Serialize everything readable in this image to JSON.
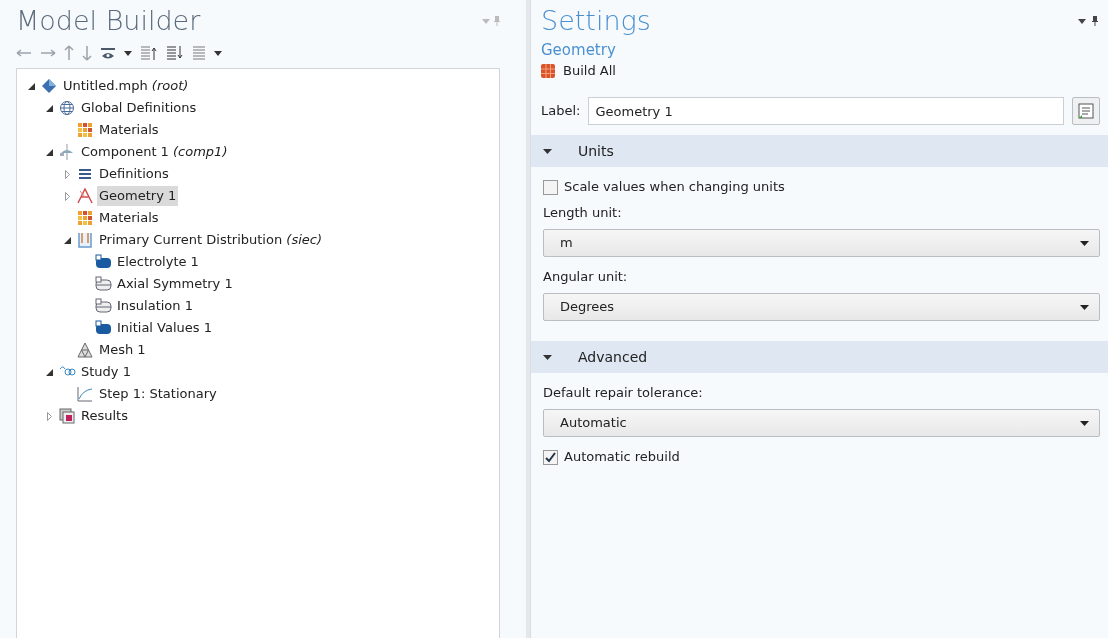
{
  "model_builder": {
    "title": "Model Builder",
    "toolbar": [
      {
        "kind": "back"
      },
      {
        "kind": "forward"
      },
      {
        "kind": "up"
      },
      {
        "kind": "down"
      },
      {
        "kind": "eye"
      },
      {
        "kind": "caret"
      },
      {
        "kind": "list-up"
      },
      {
        "kind": "list-down"
      },
      {
        "kind": "list"
      },
      {
        "kind": "caret"
      }
    ],
    "tree": [
      {
        "label": "Untitled.mph *(root)*",
        "kind": "root",
        "expanded": true,
        "selected": false,
        "children": [
          {
            "label": "Global Definitions",
            "kind": "globe",
            "expanded": true,
            "selected": false,
            "children": [
              {
                "label": "Materials",
                "kind": "materials",
                "selected": false
              }
            ]
          },
          {
            "label": "Component 1 *(comp1)*",
            "kind": "component",
            "expanded": true,
            "selected": false,
            "children": [
              {
                "label": "Definitions",
                "kind": "definitions",
                "expanded": false,
                "selected": false
              },
              {
                "label": "Geometry 1",
                "kind": "geometry",
                "expanded": false,
                "selected": true
              },
              {
                "label": "Materials",
                "kind": "materials",
                "selected": false
              },
              {
                "label": "Primary Current Distribution *(siec)*",
                "kind": "physics",
                "expanded": true,
                "selected": false,
                "children": [
                  {
                    "label": "Electrolyte 1",
                    "kind": "domain",
                    "selected": false
                  },
                  {
                    "label": "Axial Symmetry 1",
                    "kind": "boundary",
                    "selected": false
                  },
                  {
                    "label": "Insulation 1",
                    "kind": "boundary",
                    "selected": false
                  },
                  {
                    "label": "Initial Values 1",
                    "kind": "domain",
                    "selected": false
                  }
                ]
              },
              {
                "label": "Mesh 1",
                "kind": "mesh",
                "selected": false
              }
            ]
          },
          {
            "label": "Study 1",
            "kind": "study",
            "expanded": true,
            "selected": false,
            "children": [
              {
                "label": "Step 1: Stationary",
                "kind": "step",
                "selected": false
              }
            ]
          },
          {
            "label": "Results",
            "kind": "results",
            "expanded": false,
            "selected": false
          }
        ]
      }
    ]
  },
  "settings": {
    "title": "Settings",
    "subtitle": "Geometry",
    "action": "Build All",
    "label_field": {
      "label": "Label:",
      "value": "Geometry 1"
    },
    "sections": [
      {
        "title": "Units",
        "expanded": true,
        "items": [
          {
            "kind": "checkbox",
            "label": "Scale values when changing units",
            "checked": false
          },
          {
            "kind": "select",
            "label": "Length unit:",
            "value": "m"
          },
          {
            "kind": "select",
            "label": "Angular unit:",
            "value": "Degrees"
          }
        ]
      },
      {
        "title": "Advanced",
        "expanded": true,
        "items": [
          {
            "kind": "select",
            "label": "Default repair tolerance:",
            "value": "Automatic"
          },
          {
            "kind": "checkbox",
            "label": "Automatic rebuild",
            "checked": true
          }
        ]
      }
    ]
  }
}
